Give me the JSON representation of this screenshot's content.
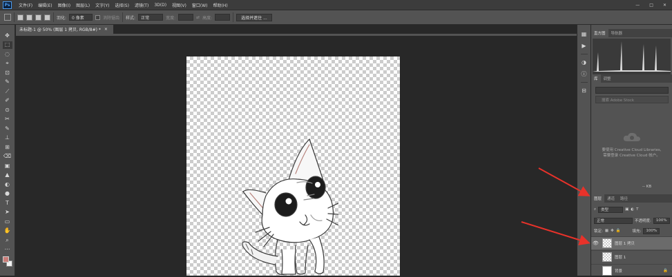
{
  "app": {
    "logo_text": "Ps"
  },
  "menu": [
    "文件(F)",
    "编辑(E)",
    "图像(I)",
    "图层(L)",
    "文字(Y)",
    "选择(S)",
    "滤镜(T)",
    "3D(D)",
    "视图(V)",
    "窗口(W)",
    "帮助(H)"
  ],
  "window_controls": {
    "minimize": "—",
    "maximize": "□",
    "close": "✕"
  },
  "options_bar": {
    "feather_label": "羽化:",
    "feather_value": "0 像素",
    "antialias_label": "消除锯齿",
    "style_label": "样式:",
    "style_value": "正常",
    "width_label": "宽度:",
    "height_label": "高度:",
    "swap_glyph": "⇄",
    "select_mask_button": "选择并遮住 ..."
  },
  "document": {
    "tab_title": "未标题-1 @ 50% (图层 1 拷贝, RGB/8#) *",
    "tab_close": "×"
  },
  "tools": [
    "✥",
    "⬚",
    "◌",
    "⌖",
    "⊡",
    "✎",
    "⟋",
    "✐",
    "⊙",
    "✂",
    "✎",
    "⊥",
    "⊞",
    "⌫",
    "▣",
    "▲",
    "◐",
    "●",
    "T",
    "➤",
    "▭",
    "✋",
    "⌕",
    "⋯"
  ],
  "dock_icons": [
    {
      "name": "histogram-icon",
      "glyph": "▦"
    },
    {
      "name": "play-icon",
      "glyph": "▶"
    },
    {
      "name": "adjustments-icon",
      "glyph": "◑"
    },
    {
      "name": "info-icon",
      "glyph": "ⓘ"
    },
    {
      "name": "properties-icon",
      "glyph": "⊟"
    }
  ],
  "panels": {
    "top_tabs": [
      "直方图",
      "导航器"
    ],
    "library_tabs": [
      "库",
      "调整"
    ],
    "library_search_placeholder": "搜索 Adobe Stock",
    "library_message_1": "要使用 Creative Cloud Libraries,",
    "library_message_2": "需要登录 Creative Cloud 帐户。",
    "library_footer": "-- KB",
    "layers_tabs": [
      "图层",
      "通道",
      "路径"
    ],
    "kind_label": "类型",
    "blend_mode": "正常",
    "opacity_label": "不透明度:",
    "opacity_value": "100%",
    "lock_label": "锁定:",
    "fill_label": "填充:",
    "fill_value": "100%",
    "layers": [
      {
        "name": "图层 1 拷贝",
        "visible": true,
        "selected": true
      },
      {
        "name": "图层 1",
        "visible": false,
        "selected": false
      },
      {
        "name": "背景",
        "visible": false,
        "selected": false
      }
    ]
  },
  "colors": {
    "foreground": "#c97c78",
    "background": "#f2f2f2",
    "annotation_arrow": "#e8322a"
  }
}
